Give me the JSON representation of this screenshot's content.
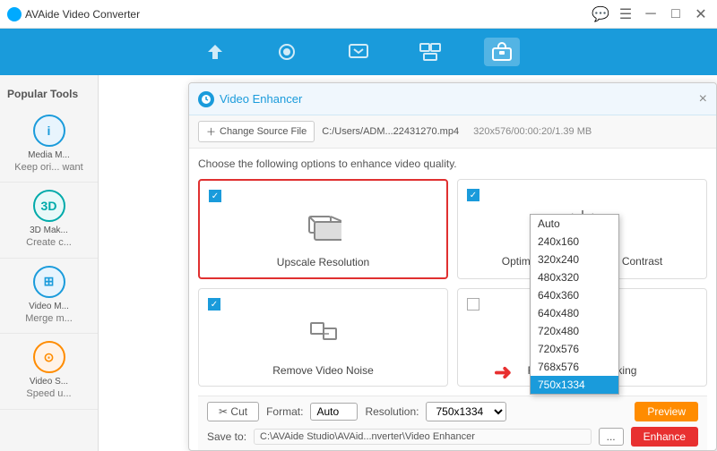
{
  "app": {
    "title": "AVAide Video Converter",
    "logo_text": "AVAide Video Converter"
  },
  "title_bar": {
    "controls": [
      "chat-icon",
      "menu-icon",
      "minimize-icon",
      "maximize-icon",
      "close-icon"
    ]
  },
  "nav": {
    "items": [
      {
        "label": "Convert",
        "icon": "convert"
      },
      {
        "label": "Compress",
        "icon": "compress"
      },
      {
        "label": "Edit",
        "icon": "edit"
      },
      {
        "label": "Merge",
        "icon": "merge"
      },
      {
        "label": "Toolbox",
        "icon": "toolbox",
        "active": true
      }
    ]
  },
  "sidebar": {
    "title": "Popular Tools",
    "items": [
      {
        "id": "media-metadata",
        "label": "Media M...",
        "desc": "Keep ori...",
        "icon_type": "blue",
        "icon_text": "i"
      },
      {
        "id": "3d-maker",
        "label": "3D Mak...",
        "desc": "Create c...",
        "icon_type": "teal",
        "icon_text": "3D"
      },
      {
        "id": "video-merge",
        "label": "Video M...",
        "desc": "Merge m...",
        "icon_type": "blue",
        "icon_text": "⊞"
      },
      {
        "id": "video-speed",
        "label": "Video S...",
        "desc": "Speed u...",
        "icon_type": "orange",
        "icon_text": "⊙"
      }
    ]
  },
  "dialog": {
    "title": "Video Enhancer",
    "close_label": "×",
    "source_bar": {
      "add_btn": "Change Source File",
      "file_path": "C:/Users/ADM...22431270.mp4",
      "file_info": "320x576/00:00:20/1.39 MB"
    },
    "hint": "Choose the following options to enhance video quality.",
    "options": [
      {
        "id": "upscale",
        "label": "Upscale Resolution",
        "checked": true,
        "selected": true
      },
      {
        "id": "brightness",
        "label": "Optimize Brightness and Contrast",
        "checked": true,
        "selected": false
      },
      {
        "id": "noise",
        "label": "Remove Video Noise",
        "checked": true,
        "selected": false
      },
      {
        "id": "shaking",
        "label": "Reduce Video Shaking",
        "checked": false,
        "selected": false
      }
    ],
    "bottom": {
      "cut_label": "Cut",
      "format_label": "Format:",
      "format_value": "Auto",
      "resolution_label": "Resolution:",
      "resolution_value": "750x1334",
      "preview_btn": "Preview",
      "save_label": "Save to:",
      "save_path": "C:\\AVAide Studio\\AVAid...nverter\\Video Enhancer",
      "browse_btn": "...",
      "enhance_btn": "Enhance"
    },
    "dropdown": {
      "options": [
        "Auto",
        "240x160",
        "320x240",
        "480x320",
        "640x360",
        "640x480",
        "720x480",
        "720x576",
        "768x576",
        "750x1334"
      ],
      "selected": "750x1334"
    }
  },
  "bg_items": [
    {
      "text": "Keep ori... want"
    },
    {
      "text": "Create c... s to the perfect"
    },
    {
      "text": "Merge m..."
    },
    {
      "text": "Speed u... as you like ease"
    }
  ]
}
